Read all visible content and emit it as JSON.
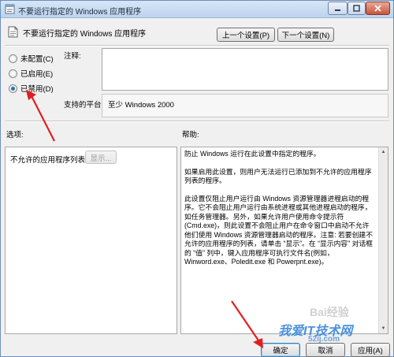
{
  "window": {
    "title": "不要运行指定的 Windows 应用程序",
    "colors": {
      "accent": "#2a6db5",
      "arrow": "#e02020",
      "watermark": "#2b7fd8"
    }
  },
  "header": {
    "policy_title": "不要运行指定的 Windows 应用程序",
    "prev_button": "上一个设置(P)",
    "next_button": "下一个设置(N)"
  },
  "state_options": [
    {
      "label": "未配置(C)",
      "selected": false
    },
    {
      "label": "已启用(E)",
      "selected": false
    },
    {
      "label": "已禁用(D)",
      "selected": true
    }
  ],
  "comment": {
    "label": "注释:",
    "value": ""
  },
  "platform": {
    "label": "支持的平台:",
    "value": "至少 Windows 2000"
  },
  "options": {
    "label": "选项:",
    "list_label": "不允许的应用程序列表",
    "show_button": "显示..."
  },
  "help": {
    "label": "帮助:",
    "paragraphs": [
      "防止 Windows 运行在此设置中指定的程序。",
      "如果启用此设置，则用户无法运行已添加到不允许的应用程序列表的程序。",
      "此设置仅阻止用户运行由 Windows 资源管理器进程启动的程序。它不会阻止用户运行由系统进程或其他进程启动的程序，如任务管理器。另外，如果允许用户使用命令提示符(Cmd.exe)，则此设置不会阻止用户在命令窗口中启动不允许他们使用 Windows 资源管理器启动的程序。注意: 若要创建不允许的应用程序的列表，请单击 “显示”。在 “显示内容” 对话框的 “值” 列中，键入应用程序可执行文件名(例如，Winword.exe、Poledit.exe 和 Powerpnt.exe)。"
    ]
  },
  "footer": {
    "ok_button": "确定",
    "cancel_button": "取消",
    "apply_button": "应用(A)"
  },
  "watermark": {
    "main": "我爱IT技术网",
    "url": "52ij.com",
    "baidu": "Bai",
    "baidu_suffix": "经验"
  }
}
